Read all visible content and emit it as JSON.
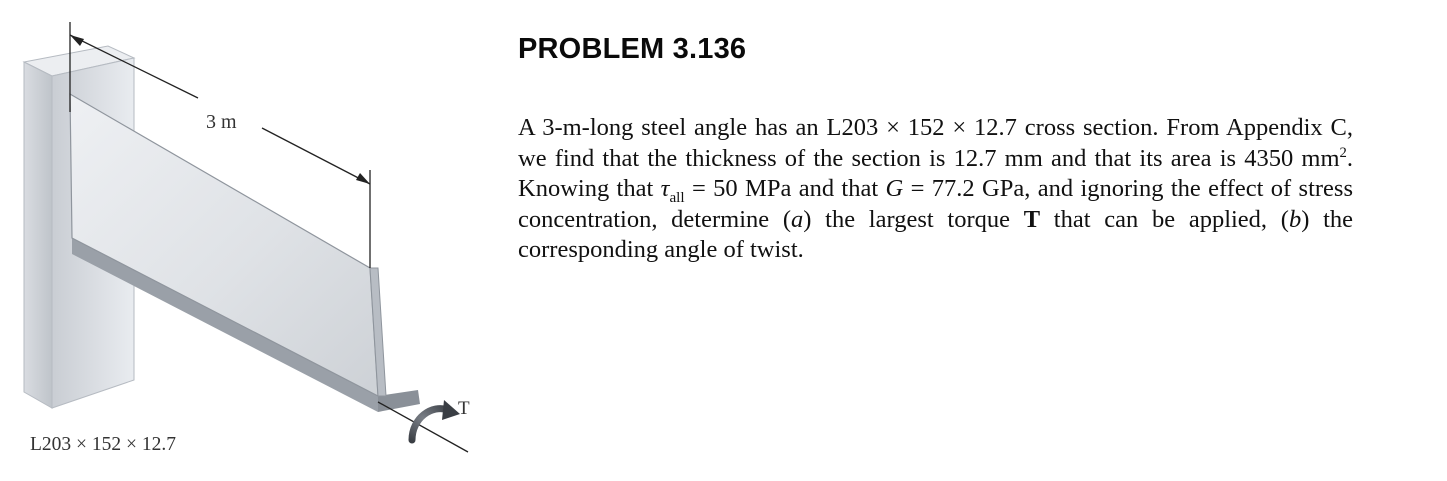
{
  "figure": {
    "length_label": "3 m",
    "torque_label": "T",
    "section_label": "L203 × 152 × 12.7"
  },
  "problem": {
    "title": "PROBLEM 3.136",
    "p1": "A 3-m-long steel angle has an ",
    "section": "L203 × 152 × 12.7",
    "p2": " cross section. From Appendix C, we find that the thickness of the section is 12.7 mm and that its area is 4350 mm",
    "area_exp": "2",
    "p3": ". Knowing that ",
    "tau_symbol": "τ",
    "tau_sub": "all",
    "tau_value": " = 50 MPa",
    "p4": " and that ",
    "g_symbol": "G",
    "g_value": " = 77.2 GPa,",
    "p5": " and ignoring the effect of stress concentration, determine (",
    "part_a": "a",
    "p6": ") the largest torque ",
    "torque": "T",
    "p7": " that can be applied, (",
    "part_b": "b",
    "p8": ") the corresponding angle of twist."
  }
}
